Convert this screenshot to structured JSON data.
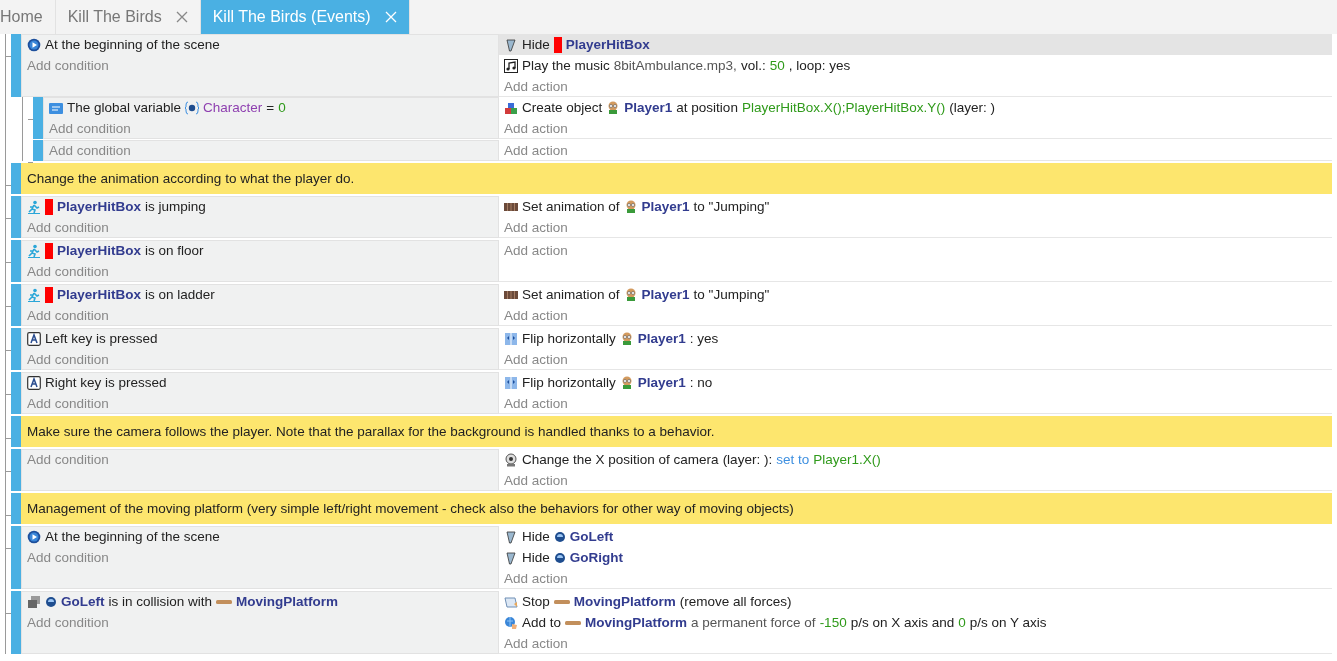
{
  "tabs": [
    {
      "label": "Home",
      "closable": false,
      "selected": false
    },
    {
      "label": "Kill The Birds",
      "closable": true,
      "selected": false
    },
    {
      "label": "Kill The Birds (Events)",
      "closable": true,
      "selected": true
    }
  ],
  "events": [
    {
      "kind": "standard",
      "conditions": [
        {
          "kind": "trigger",
          "selected": false,
          "segments": [
            {
              "kind": "text",
              "text": "At the beginning of the scene"
            }
          ]
        }
      ],
      "add_condition": "Add condition",
      "actions": [
        {
          "kind": "hide",
          "selected": true,
          "segments": [
            {
              "kind": "text",
              "text": "Hide"
            },
            {
              "kind": "box",
              "text": "PlayerHitBox"
            }
          ]
        },
        {
          "kind": "music",
          "selected": false,
          "segments": [
            {
              "kind": "text",
              "text": "Play the music"
            },
            {
              "kind": "param",
              "text": "8bitAmbulance.mp3,"
            },
            {
              "kind": "text",
              "text": "vol.:"
            },
            {
              "kind": "value",
              "text": "50"
            },
            {
              "kind": "text",
              "text": ", loop: yes"
            }
          ]
        }
      ],
      "add_action": "Add action",
      "children": [
        {
          "kind": "standard",
          "conditions": [
            {
              "kind": "variable",
              "selected": false,
              "segments": [
                {
                  "kind": "text",
                  "text": "The global variable"
                },
                {
                  "kind": "variable",
                  "text": "Character"
                },
                {
                  "kind": "text",
                  "text": "="
                },
                {
                  "kind": "value",
                  "text": "0"
                }
              ]
            }
          ],
          "add_condition": "Add condition",
          "actions": [
            {
              "kind": "create",
              "selected": false,
              "segments": [
                {
                  "kind": "text",
                  "text": "Create object"
                },
                {
                  "kind": "sprite",
                  "text": "Player1"
                },
                {
                  "kind": "text",
                  "text": "at position"
                },
                {
                  "kind": "value",
                  "text": "PlayerHitBox.X();PlayerHitBox.Y()"
                },
                {
                  "kind": "text",
                  "text": "(layer: )"
                }
              ]
            }
          ],
          "add_action": "Add action"
        },
        {
          "kind": "standard",
          "add_condition": "Add condition",
          "add_action": "Add action"
        }
      ]
    },
    {
      "kind": "comment",
      "text": "Change the animation according to what the player do."
    },
    {
      "kind": "standard",
      "conditions": [
        {
          "kind": "behavior",
          "selected": false,
          "segments": [
            {
              "kind": "box",
              "text": "PlayerHitBox"
            },
            {
              "kind": "text",
              "text": "is jumping"
            }
          ]
        }
      ],
      "add_condition": "Add condition",
      "actions": [
        {
          "kind": "animation",
          "selected": false,
          "segments": [
            {
              "kind": "text",
              "text": "Set animation of"
            },
            {
              "kind": "sprite",
              "text": "Player1"
            },
            {
              "kind": "text",
              "text": "to \"Jumping\""
            }
          ]
        }
      ],
      "add_action": "Add action"
    },
    {
      "kind": "standard",
      "conditions": [
        {
          "kind": "behavior",
          "selected": false,
          "segments": [
            {
              "kind": "box",
              "text": "PlayerHitBox"
            },
            {
              "kind": "text",
              "text": "is on floor"
            }
          ]
        }
      ],
      "add_condition": "Add condition",
      "add_action": "Add action"
    },
    {
      "kind": "standard",
      "conditions": [
        {
          "kind": "behavior",
          "selected": false,
          "segments": [
            {
              "kind": "box",
              "text": "PlayerHitBox"
            },
            {
              "kind": "text",
              "text": "is on ladder"
            }
          ]
        }
      ],
      "add_condition": "Add condition",
      "actions": [
        {
          "kind": "animation",
          "selected": false,
          "segments": [
            {
              "kind": "text",
              "text": "Set animation of"
            },
            {
              "kind": "sprite",
              "text": "Player1"
            },
            {
              "kind": "text",
              "text": "to \"Jumping\""
            }
          ]
        }
      ],
      "add_action": "Add action"
    },
    {
      "kind": "standard",
      "conditions": [
        {
          "kind": "key",
          "selected": false,
          "segments": [
            {
              "kind": "text",
              "text": "Left key is pressed"
            }
          ]
        }
      ],
      "add_condition": "Add condition",
      "actions": [
        {
          "kind": "flip",
          "selected": false,
          "segments": [
            {
              "kind": "text",
              "text": "Flip horizontally"
            },
            {
              "kind": "sprite",
              "text": "Player1"
            },
            {
              "kind": "text",
              "text": ": yes"
            }
          ]
        }
      ],
      "add_action": "Add action"
    },
    {
      "kind": "standard",
      "conditions": [
        {
          "kind": "key",
          "selected": false,
          "segments": [
            {
              "kind": "text",
              "text": "Right key is pressed"
            }
          ]
        }
      ],
      "add_condition": "Add condition",
      "actions": [
        {
          "kind": "flip",
          "selected": false,
          "segments": [
            {
              "kind": "text",
              "text": "Flip horizontally"
            },
            {
              "kind": "sprite",
              "text": "Player1"
            },
            {
              "kind": "text",
              "text": ": no"
            }
          ]
        }
      ],
      "add_action": "Add action"
    },
    {
      "kind": "comment",
      "text": "Make sure the camera follows the player. Note that the parallax for the background is handled thanks to a behavior."
    },
    {
      "kind": "standard",
      "add_condition": "Add condition",
      "actions": [
        {
          "kind": "camera",
          "selected": false,
          "segments": [
            {
              "kind": "text",
              "text": "Change the X position of camera"
            },
            {
              "kind": "text",
              "text": "(layer: ):"
            },
            {
              "kind": "keyword",
              "text": "set to"
            },
            {
              "kind": "value",
              "text": "Player1.X()"
            }
          ]
        }
      ],
      "add_action": "Add action"
    },
    {
      "kind": "comment",
      "text": "Management of the moving platform (very simple left/right movement - check also the behaviors for other way of moving objects)"
    },
    {
      "kind": "standard",
      "conditions": [
        {
          "kind": "trigger",
          "selected": false,
          "segments": [
            {
              "kind": "text",
              "text": "At the beginning of the scene"
            }
          ]
        }
      ],
      "add_condition": "Add condition",
      "actions": [
        {
          "kind": "hide",
          "selected": false,
          "segments": [
            {
              "kind": "text",
              "text": "Hide"
            },
            {
              "kind": "orb",
              "text": "GoLeft"
            }
          ]
        },
        {
          "kind": "hide",
          "selected": false,
          "segments": [
            {
              "kind": "text",
              "text": "Hide"
            },
            {
              "kind": "orb",
              "text": "GoRight"
            }
          ]
        }
      ],
      "add_action": "Add action"
    },
    {
      "kind": "standard",
      "conditions": [
        {
          "kind": "collision",
          "selected": false,
          "segments": [
            {
              "kind": "orb",
              "text": "GoLeft"
            },
            {
              "kind": "text",
              "text": "is in collision with"
            },
            {
              "kind": "bar",
              "text": "MovingPlatform"
            }
          ]
        }
      ],
      "add_condition": "Add condition",
      "actions": [
        {
          "kind": "stop",
          "selected": false,
          "segments": [
            {
              "kind": "text",
              "text": "Stop"
            },
            {
              "kind": "bar",
              "text": "MovingPlatform"
            },
            {
              "kind": "text",
              "text": "(remove all forces)"
            }
          ]
        },
        {
          "kind": "force",
          "selected": false,
          "segments": [
            {
              "kind": "text",
              "text": "Add to"
            },
            {
              "kind": "bar",
              "text": "MovingPlatform"
            },
            {
              "kind": "param",
              "text": "a permanent force of"
            },
            {
              "kind": "value",
              "text": "-150"
            },
            {
              "kind": "text",
              "text": "p/s on X axis and"
            },
            {
              "kind": "value",
              "text": "0"
            },
            {
              "kind": "text",
              "text": "p/s on Y axis"
            }
          ]
        }
      ],
      "add_action": "Add action"
    }
  ]
}
